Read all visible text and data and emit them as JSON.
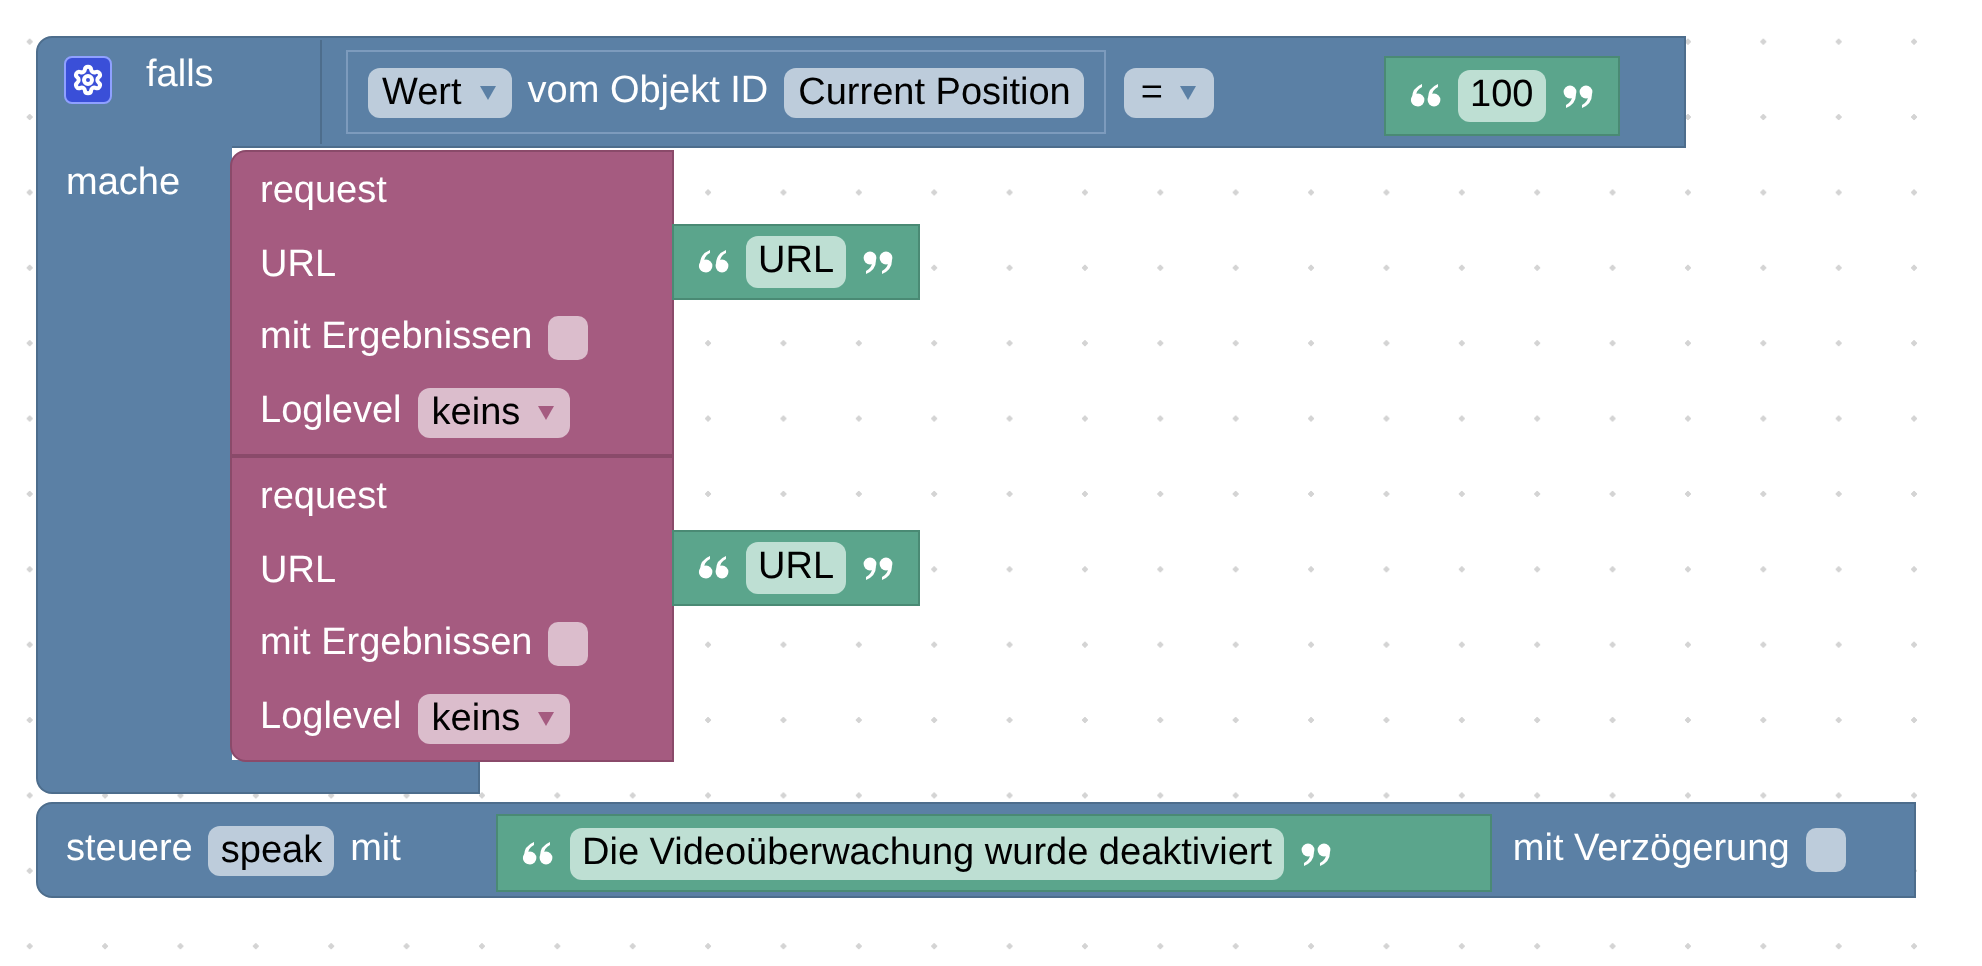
{
  "if_block": {
    "label": "falls",
    "condition": {
      "property": "Wert",
      "of_label": "vom Objekt ID",
      "object_id": "Current Position",
      "operator": "=",
      "value": "100"
    },
    "do_label": "mache",
    "statements": [
      {
        "title": "request",
        "url_label": "URL",
        "url": "URL",
        "results_label": "mit Ergebnissen",
        "results_checked": false,
        "loglevel_label": "Loglevel",
        "loglevel": "keins"
      },
      {
        "title": "request",
        "url_label": "URL",
        "url": "URL",
        "results_label": "mit Ergebnissen",
        "results_checked": false,
        "loglevel_label": "Loglevel",
        "loglevel": "keins"
      }
    ]
  },
  "control_block": {
    "label": "steuere",
    "target": "speak",
    "with_label": "mit",
    "text": "Die Videoüberwachung wurde deaktiviert",
    "delay_label": "mit Verzögerung",
    "delay_checked": false
  }
}
